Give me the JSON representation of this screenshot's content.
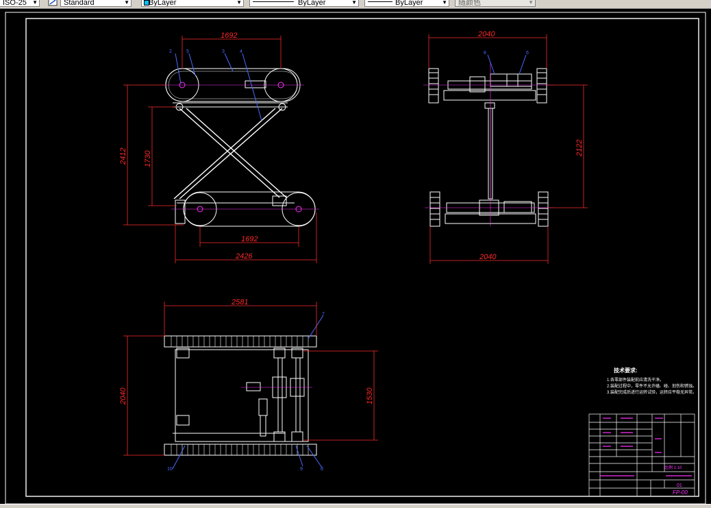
{
  "toolbar": {
    "textstyle_value": "ISO-25",
    "dimstyle_value": "Standard",
    "layer_color_value": "ByLayer",
    "linetype_value": "ByLayer",
    "lineweight_value": "ByLayer",
    "plotstyle_value": "随颜色",
    "colors": {
      "face": "#d4d0c8",
      "field": "#ffffff",
      "layer_swatch": "#00c0ff"
    }
  },
  "drawing": {
    "background": "#000000",
    "frame_color": "#ffffff",
    "dim_color": "#ff2a2a",
    "label_color": "#4a6bff",
    "part_color": "#ffffff",
    "centerline_color": "#ff33ff",
    "front_view": {
      "dims": {
        "top_span": "1692",
        "bottom_span": "1692",
        "overall_width": "2426",
        "overall_height": "2412",
        "inner_height": "1730"
      },
      "labels": [
        "2",
        "5",
        "3",
        "4"
      ]
    },
    "side_view": {
      "dims": {
        "top_width": "2040",
        "bottom_width": "2040",
        "height": "2122"
      },
      "labels": [
        "8",
        "6"
      ]
    },
    "top_view": {
      "dims": {
        "length": "2581",
        "width": "2040",
        "inner": "1530"
      },
      "labels": [
        "7",
        "10",
        "9",
        "8"
      ]
    },
    "tech_requirements": {
      "title": "技术要求:",
      "items": [
        "1.各零部件装配前应清洗干净。",
        "2.装配过程中，零件不允许磕、碰、划伤和锈蚀。",
        "3.装配完成后进行运转试验，运转应平稳无异常。"
      ]
    },
    "title_block": {
      "drawing_no": "FP-00",
      "sheet": "01",
      "scale": "比例 1:10"
    }
  }
}
